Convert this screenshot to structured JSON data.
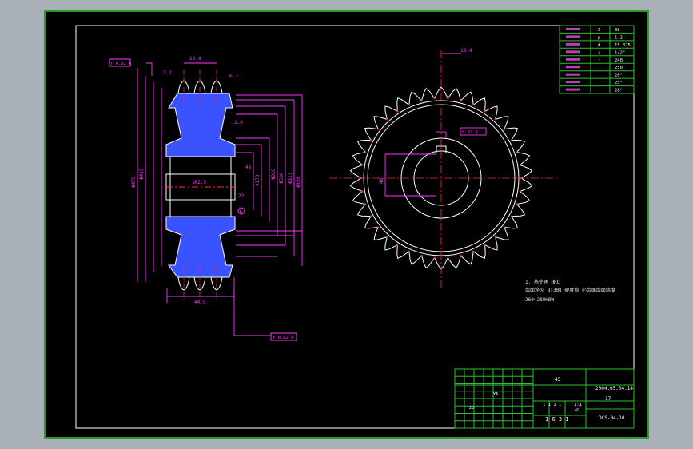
{
  "title_block": {
    "scale": "1:1",
    "date": "2004.05.04.14",
    "drawing_no": "DCS-04-10",
    "material": "45",
    "sheet_count": "17",
    "weight": "1 6 3 1",
    "ratio_row": "1 1 1 1",
    "mark_49": "49",
    "mark_25": "25",
    "mark_ya": "YA"
  },
  "param_table": {
    "values": [
      "38",
      "1.2",
      "15.875",
      "1/2\"",
      "240",
      "250",
      "20°",
      "25°",
      "28°"
    ],
    "symbols": [
      "Z",
      "p",
      "d",
      "s",
      "r"
    ]
  },
  "notes": {
    "line1": "1. 热处理  HRC",
    "line2": "齿面淬火 BT308  硬度值  小齿面齿面精度",
    "line3": "260~280HBW"
  },
  "datum": {
    "label": "A",
    "tol_frame_top": "f 0.02 A",
    "tol_frame_bottom": "f 0.02 A",
    "tol_frame_center": "0.02 A"
  },
  "dimensions": {
    "hub_width": "44.5",
    "top_width": "18.4",
    "bore": "48",
    "keyway": "22",
    "phi_outer": "Φ475",
    "phi_a": "Φ415",
    "phi_b": "Φ350",
    "phi_c": "Φ321",
    "phi_d": "Φ300",
    "phi_e": "Φ260",
    "phi_f": "Φ170",
    "width_total": "162.5"
  },
  "roughness": {
    "r1": "3.2",
    "r2": "6.3",
    "r3": "1.6"
  },
  "colors": {
    "frame": "#2fbf2f",
    "line": "#ffffff",
    "dimension": "#ff36ff",
    "hatch": "#3a52ff",
    "center": "#ff3030",
    "note": "#e6e6e6"
  }
}
